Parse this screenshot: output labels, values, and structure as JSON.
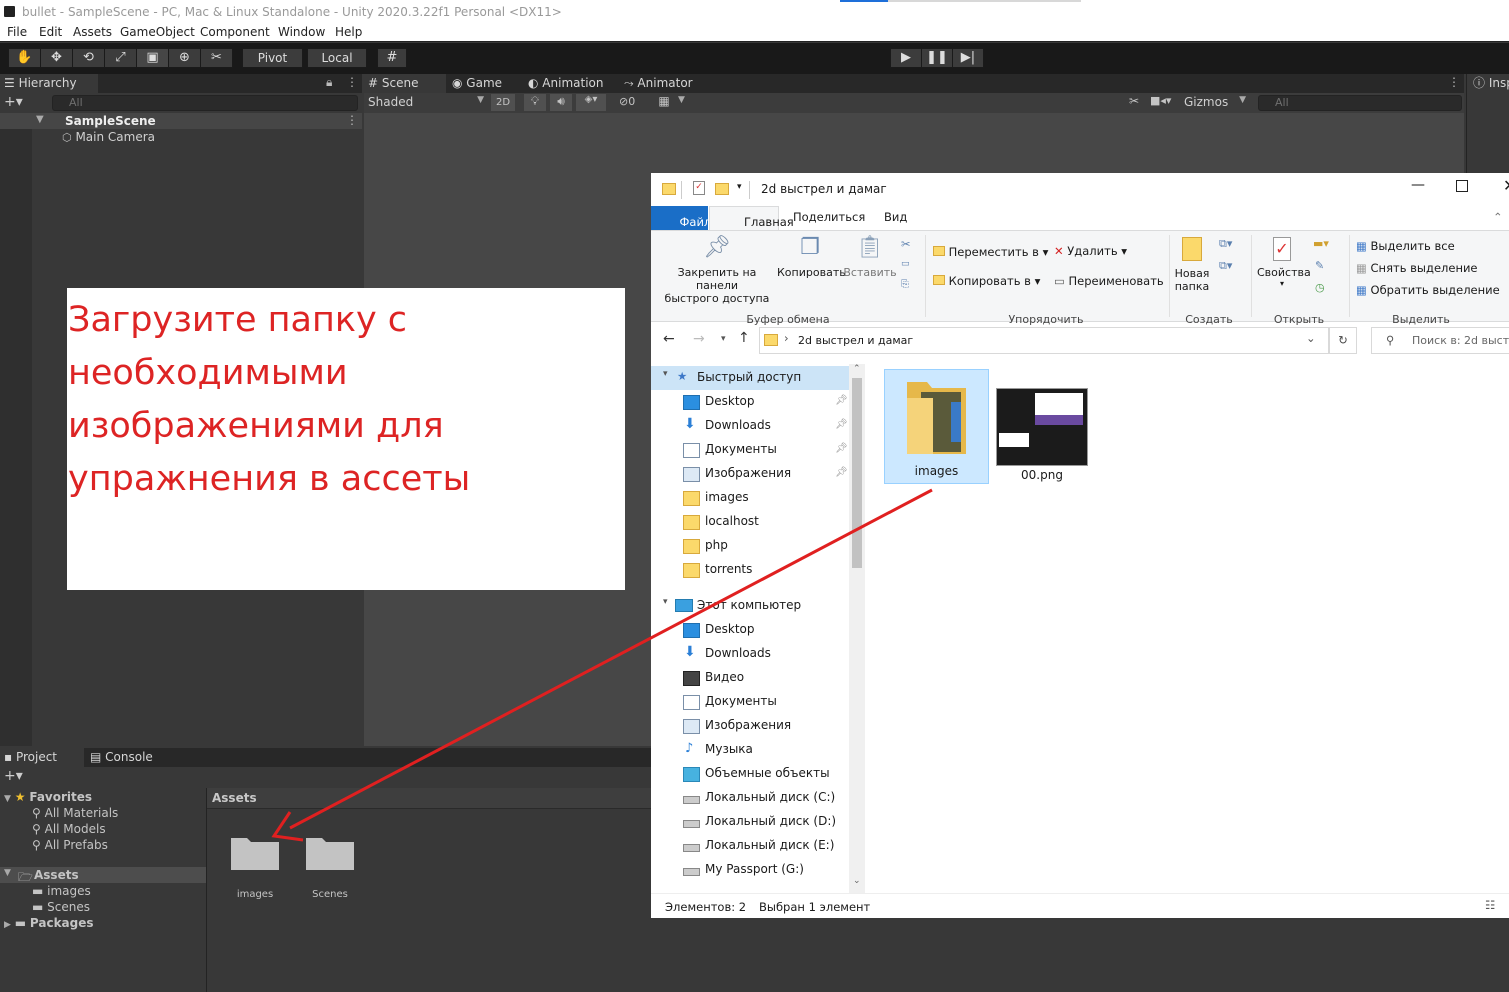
{
  "unity": {
    "title": "bullet - SampleScene - PC, Mac & Linux Standalone - Unity 2020.3.22f1 Personal <DX11>",
    "menu": [
      "File",
      "Edit",
      "Assets",
      "GameObject",
      "Component",
      "Window",
      "Help"
    ],
    "toolbar": {
      "pivot": "Pivot",
      "local": "Local"
    },
    "hierarchy": {
      "tab": "Hierarchy",
      "search_placeholder": "All",
      "scene": "SampleScene",
      "items": [
        "Main Camera"
      ]
    },
    "scene_tabs": [
      "Scene",
      "Game",
      "Animation",
      "Animator"
    ],
    "scene_toolbar": {
      "shading": "Shaded",
      "mode_2d": "2D",
      "hidden_count": "0",
      "gizmos": "Gizmos",
      "search_placeholder": "All"
    },
    "inspector_tab": "Insp",
    "bottom_tabs": [
      "Project",
      "Console"
    ],
    "project": {
      "favorites_label": "Favorites",
      "favorites": [
        "All Materials",
        "All Models",
        "All Prefabs"
      ],
      "assets_label": "Assets",
      "assets_children": [
        "images",
        "Scenes"
      ],
      "packages_label": "Packages",
      "breadcrumb": "Assets",
      "grid_items": [
        "images",
        "Scenes"
      ]
    }
  },
  "explorer": {
    "title": "2d выстрел и дамаг",
    "ribbon_tabs": [
      "Файл",
      "Главная",
      "Поделиться",
      "Вид"
    ],
    "clipboard": {
      "pin_line1": "Закрепить на панели",
      "pin_line2": "быстрого доступа",
      "copy": "Копировать",
      "paste": "Вставить",
      "group": "Буфер обмена"
    },
    "organize": {
      "move": "Переместить в",
      "copy": "Копировать в",
      "delete": "Удалить",
      "rename": "Переименовать",
      "group": "Упорядочить"
    },
    "create": {
      "new_folder_line1": "Новая",
      "new_folder_line2": "папка",
      "group": "Создать"
    },
    "open": {
      "properties": "Свойства",
      "group": "Открыть"
    },
    "select": {
      "select_all": "Выделить все",
      "deselect": "Снять выделение",
      "invert": "Обратить выделение",
      "group": "Выделить"
    },
    "address": "2d выстрел и дамаг",
    "search_placeholder": "Поиск в: 2d выст...",
    "nav": {
      "quick_access": "Быстрый доступ",
      "quick_items": [
        {
          "label": "Desktop",
          "icon": "desktop-icon",
          "pinned": true
        },
        {
          "label": "Downloads",
          "icon": "downloads-icon",
          "pinned": true
        },
        {
          "label": "Документы",
          "icon": "documents-icon",
          "pinned": true
        },
        {
          "label": "Изображения",
          "icon": "pictures-icon",
          "pinned": true
        },
        {
          "label": "images",
          "icon": "folder-icon",
          "pinned": false
        },
        {
          "label": "localhost",
          "icon": "folder-icon",
          "pinned": false
        },
        {
          "label": "php",
          "icon": "folder-icon",
          "pinned": false
        },
        {
          "label": "torrents",
          "icon": "folder-icon",
          "pinned": false
        }
      ],
      "this_pc": "Этот компьютер",
      "pc_items": [
        {
          "label": "Desktop",
          "icon": "desktop-icon"
        },
        {
          "label": "Downloads",
          "icon": "downloads-icon"
        },
        {
          "label": "Видео",
          "icon": "video-icon"
        },
        {
          "label": "Документы",
          "icon": "documents-icon"
        },
        {
          "label": "Изображения",
          "icon": "pictures-icon"
        },
        {
          "label": "Музыка",
          "icon": "music-icon"
        },
        {
          "label": "Объемные объекты",
          "icon": "3d-objects-icon"
        },
        {
          "label": "Локальный диск (C:)",
          "icon": "drive-icon"
        },
        {
          "label": "Локальный диск (D:)",
          "icon": "drive-icon"
        },
        {
          "label": "Локальный диск (E:)",
          "icon": "drive-icon"
        },
        {
          "label": "My Passport (G:)",
          "icon": "drive-icon"
        }
      ]
    },
    "files": [
      {
        "name": "images",
        "type": "folder",
        "selected": true
      },
      {
        "name": "00.png",
        "type": "image",
        "selected": false
      }
    ],
    "status": {
      "count": "Элементов: 2",
      "selected": "Выбран 1 элемент"
    }
  },
  "annotation": {
    "text": "Загрузите папку с необходимыми изображениями для упражнения в ассеты",
    "color": "#dd2424"
  }
}
